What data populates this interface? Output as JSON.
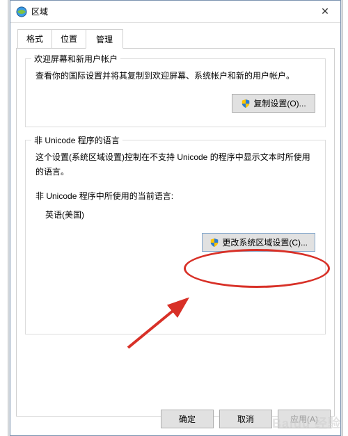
{
  "window": {
    "title": "区域",
    "close_glyph": "✕"
  },
  "tabs": {
    "format": "格式",
    "location": "位置",
    "admin": "管理"
  },
  "group_welcome": {
    "title": "欢迎屏幕和新用户帐户",
    "desc": "查看你的国际设置并将其复制到欢迎屏幕、系统帐户和新的用户帐户。",
    "copy_btn": "复制设置(O)..."
  },
  "group_nonunicode": {
    "title": "非 Unicode 程序的语言",
    "desc": "这个设置(系统区域设置)控制在不支持 Unicode 的程序中显示文本时所使用的语言。",
    "current_label": "非 Unicode 程序中所使用的当前语言:",
    "current_value": "英语(美国)",
    "change_btn": "更改系统区域设置(C)..."
  },
  "buttons": {
    "ok": "确定",
    "cancel": "取消",
    "apply": "应用(A)"
  },
  "watermark": "Baidu 经验"
}
